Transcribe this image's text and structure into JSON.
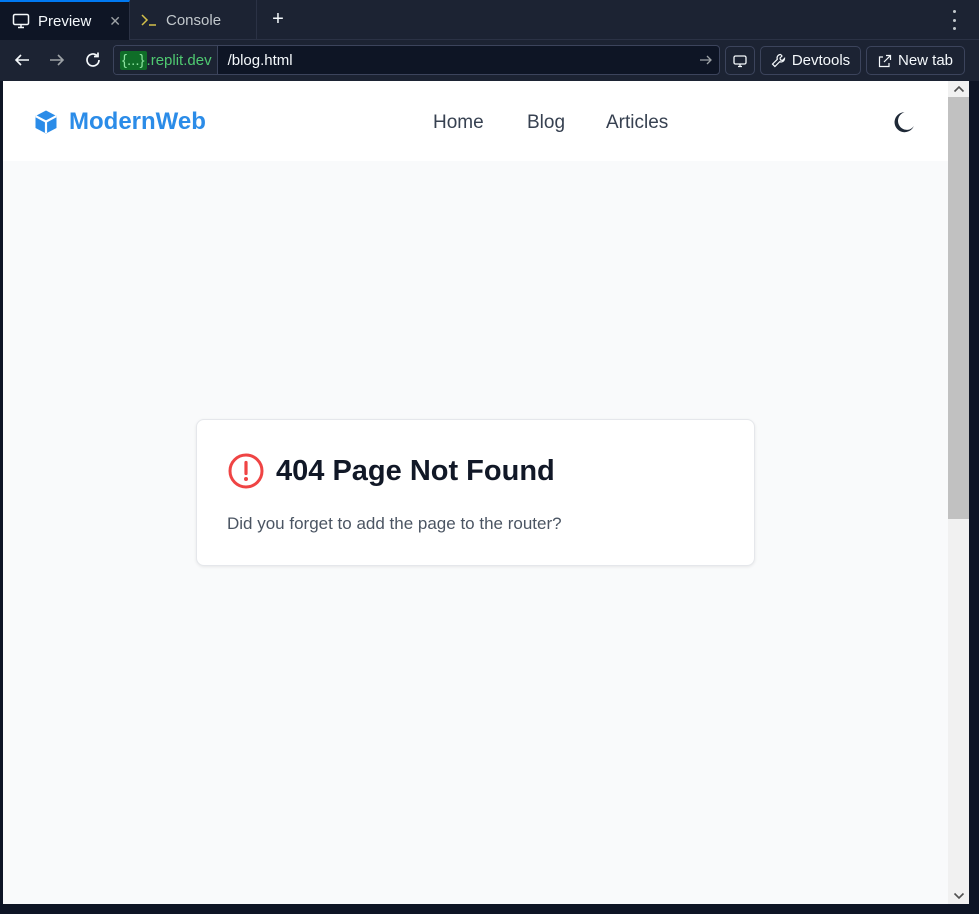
{
  "browser": {
    "tabs": [
      {
        "label": "Preview",
        "icon": "monitor-icon",
        "active": true
      },
      {
        "label": "Console",
        "icon": "terminal-icon",
        "active": false
      }
    ],
    "url_host_chip": "{...}",
    "url_host_suffix": ".replit.dev",
    "url_path": "/blog.html",
    "devtools_label": "Devtools",
    "new_tab_label": "New tab"
  },
  "site": {
    "brand": "ModernWeb",
    "nav": [
      {
        "label": "Home"
      },
      {
        "label": "Blog"
      },
      {
        "label": "Articles"
      }
    ]
  },
  "error_card": {
    "title": "404 Page Not Found",
    "description": "Did you forget to add the page to the router?"
  },
  "colors": {
    "brand": "#2b8ce8",
    "error": "#ef4444",
    "url_host": "#4fc971"
  }
}
